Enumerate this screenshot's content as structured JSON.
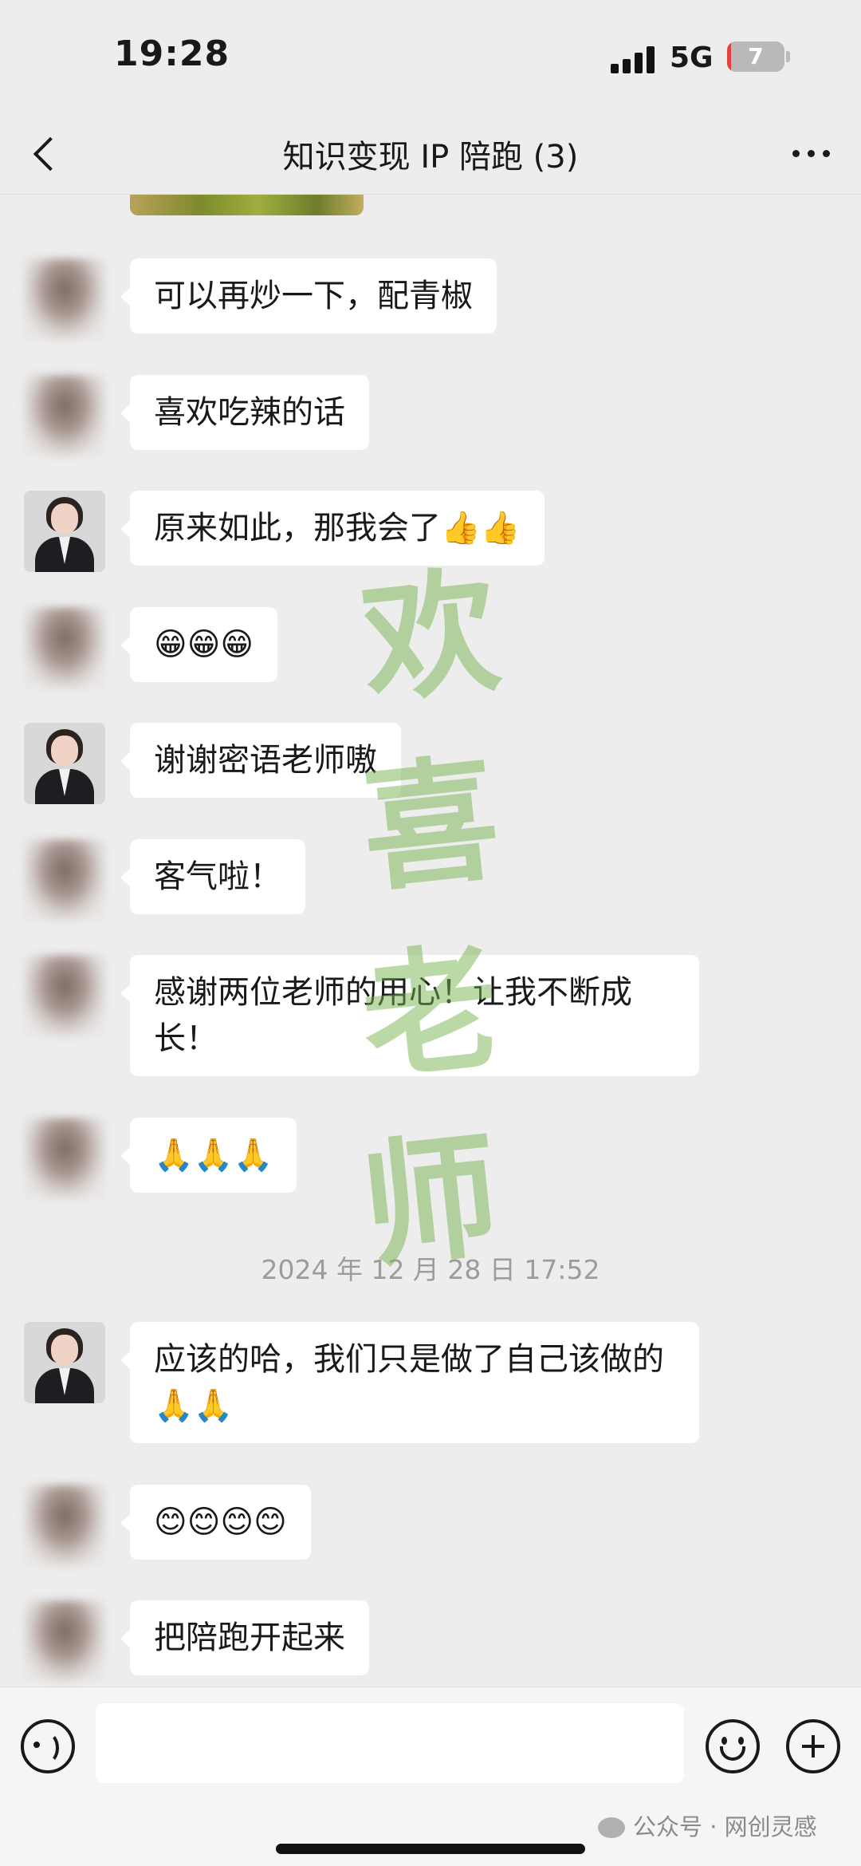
{
  "status_bar": {
    "time": "19:28",
    "network": "5G",
    "battery": "7",
    "battery_level": 0.07
  },
  "nav": {
    "title": "知识变现 IP 陪跑 (3)"
  },
  "messages": [
    {
      "avatar": "blurred",
      "text": "可以再炒一下，配青椒"
    },
    {
      "avatar": "blurred",
      "text": "喜欢吃辣的话"
    },
    {
      "avatar": "teacher",
      "text": "原来如此，那我会了👍👍"
    },
    {
      "avatar": "blurred",
      "text": "😁😁😁"
    },
    {
      "avatar": "teacher",
      "text": "谢谢密语老师嗷"
    },
    {
      "avatar": "blurred",
      "text": "客气啦！"
    },
    {
      "avatar": "blurred",
      "text": "感谢两位老师的用心！让我不断成长！"
    },
    {
      "avatar": "blurred",
      "text": "🙏🙏🙏"
    },
    {
      "avatar": "teacher",
      "text": "应该的哈，我们只是做了自己该做的🙏🙏"
    },
    {
      "avatar": "blurred",
      "text": "😊😊😊😊"
    },
    {
      "avatar": "blurred",
      "text": "把陪跑开起来"
    }
  ],
  "timestamp": "2024 年 12 月 28 日 17:52",
  "watermark": [
    "欢",
    "喜",
    "老",
    "师"
  ],
  "footer": {
    "watermark": "公众号 · 网创灵感"
  }
}
